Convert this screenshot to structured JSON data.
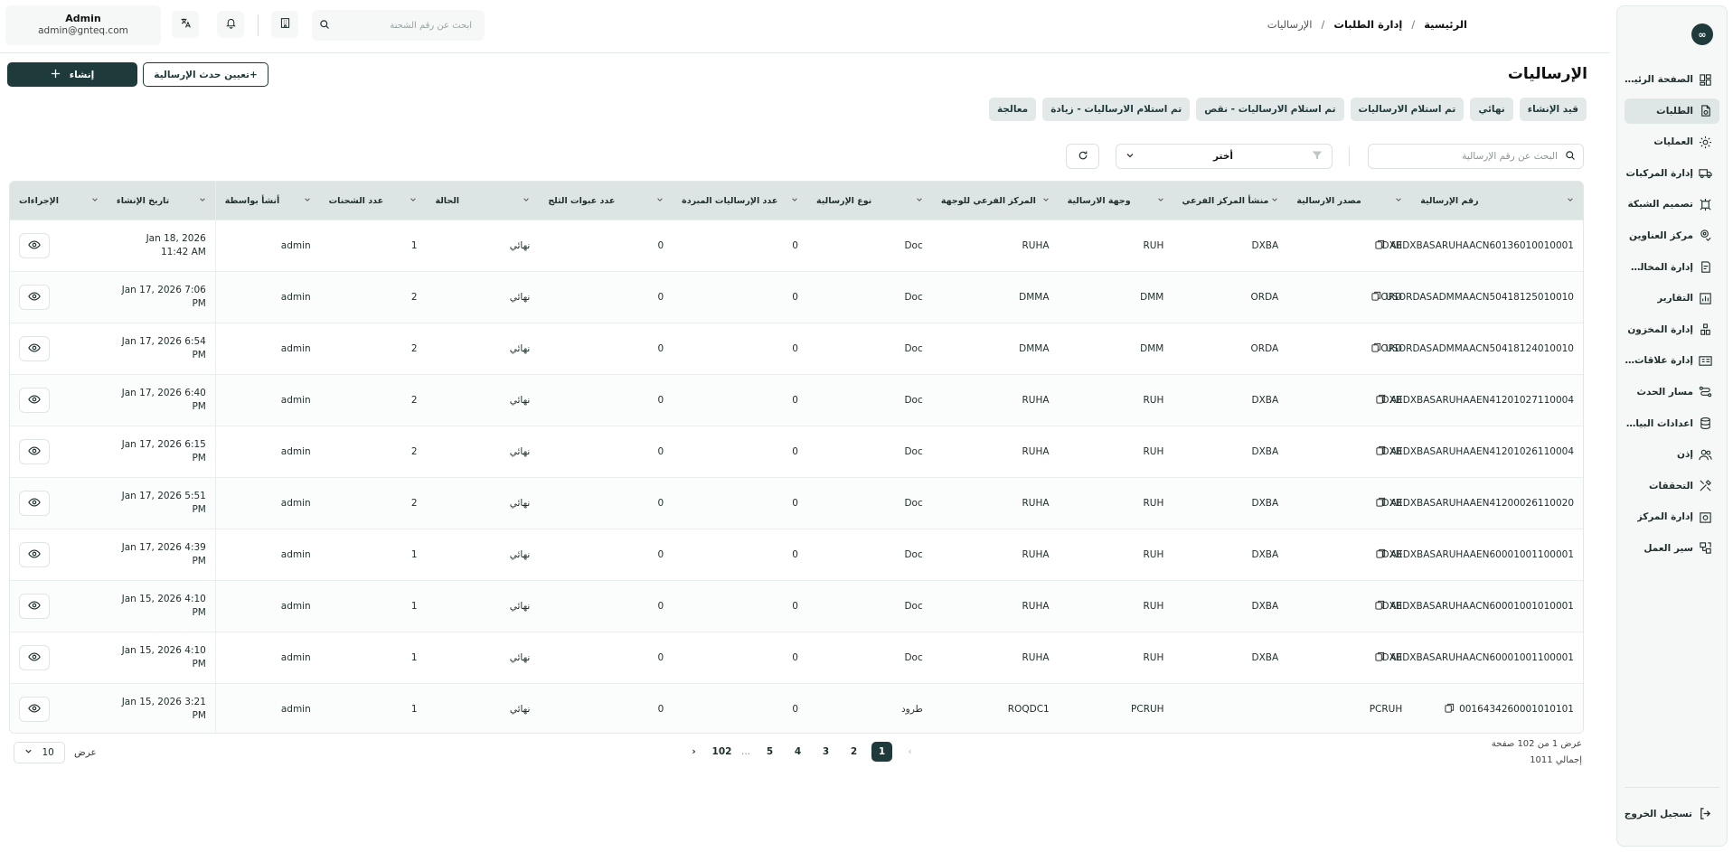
{
  "sidebar": {
    "logo": "∞",
    "items": [
      {
        "label": "الصفحة الرئيسية",
        "icon": "dashboard-icon"
      },
      {
        "label": "الطلبات",
        "icon": "orders-icon",
        "active": true
      },
      {
        "label": "العمليات",
        "icon": "operations-icon"
      },
      {
        "label": "إدارة المركبات",
        "icon": "truck-icon"
      },
      {
        "label": "تصميم الشبكة",
        "icon": "network-icon"
      },
      {
        "label": "مركز العناوين",
        "icon": "address-icon"
      },
      {
        "label": "إدارة المخالفات",
        "icon": "violation-icon"
      },
      {
        "label": "التقارير",
        "icon": "reports-icon"
      },
      {
        "label": "إدارة المخزون",
        "icon": "inventory-icon"
      },
      {
        "label": "إدارة علاقات العملاء",
        "icon": "crm-icon"
      },
      {
        "label": "مسار الحدث",
        "icon": "route-icon"
      },
      {
        "label": "اعدادات البيانات...",
        "icon": "database-icon"
      },
      {
        "label": "إذن",
        "icon": "users-icon"
      },
      {
        "label": "التحققات",
        "icon": "tools-icon"
      },
      {
        "label": "إدارة المركز",
        "icon": "center-icon"
      },
      {
        "label": "سير العمل",
        "icon": "workflow-icon"
      }
    ],
    "logout": "تسجيل الخروج"
  },
  "topbar": {
    "user_name": "Admin",
    "user_email": "admin@gnteq.com",
    "search_placeholder": "ابحث عن رقم الشحنة",
    "breadcrumb": [
      "الرئيسية",
      "إدارة الطلبات",
      "الإرساليات"
    ]
  },
  "page": {
    "title": "الإرساليات",
    "create_label": "إنشاء",
    "assign_label": "+تعيين حدث الإرسالية",
    "tabs": [
      "قيد الإنشاء",
      "نهائي",
      "تم استلام الارساليات",
      "تم استلام الارساليات - نقص",
      "تم استلام الارساليات - زيادة",
      "معالجة"
    ]
  },
  "filters": {
    "search_placeholder": "البحث عن رقم الإرسالية",
    "select_value": "أختر"
  },
  "table": {
    "columns": [
      "رقم الإرسالية",
      "مصدر الارسالية",
      "منشأ المركز الفرعي",
      "وجهة الارسالية",
      "المركز الفرعي للوجهة",
      "نوع الإرسالية",
      "عدد الإرساليات المبردة",
      "عدد عبوات الثلج",
      "الحالة",
      "عدد الشحنات",
      "أنشأ بواسطة",
      "تاريخ الإنشاء",
      "الإجراءات"
    ],
    "rows": [
      [
        "AEDXBASARUHAACN60136010010001",
        "DXB",
        "DXBA",
        "RUH",
        "RUHA",
        "Doc",
        "0",
        "0",
        "نهائي",
        "1",
        "admin",
        "Jan 18, 2026 11:42 AM"
      ],
      [
        "USORDASADMMAACN50418125010010",
        "ORD",
        "ORDA",
        "DMM",
        "DMMA",
        "Doc",
        "0",
        "0",
        "نهائي",
        "2",
        "admin",
        "Jan 17, 2026 7:06 PM"
      ],
      [
        "USORDASADMMAACN50418124010010",
        "ORD",
        "ORDA",
        "DMM",
        "DMMA",
        "Doc",
        "0",
        "0",
        "نهائي",
        "2",
        "admin",
        "Jan 17, 2026 6:54 PM"
      ],
      [
        "AEDXBASARUHAAEN41201027110004",
        "DXB",
        "DXBA",
        "RUH",
        "RUHA",
        "Doc",
        "0",
        "0",
        "نهائي",
        "2",
        "admin",
        "Jan 17, 2026 6:40 PM"
      ],
      [
        "AEDXBASARUHAAEN41201026110004",
        "DXB",
        "DXBA",
        "RUH",
        "RUHA",
        "Doc",
        "0",
        "0",
        "نهائي",
        "2",
        "admin",
        "Jan 17, 2026 6:15 PM"
      ],
      [
        "AEDXBASARUHAAEN41200026110020",
        "DXB",
        "DXBA",
        "RUH",
        "RUHA",
        "Doc",
        "0",
        "0",
        "نهائي",
        "2",
        "admin",
        "Jan 17, 2026 5:51 PM"
      ],
      [
        "AEDXBASARUHAAEN60001001100001",
        "DXB",
        "DXBA",
        "RUH",
        "RUHA",
        "Doc",
        "0",
        "0",
        "نهائي",
        "1",
        "admin",
        "Jan 17, 2026 4:39 PM"
      ],
      [
        "AEDXBASARUHAACN60001001010001",
        "DXB",
        "DXBA",
        "RUH",
        "RUHA",
        "Doc",
        "0",
        "0",
        "نهائي",
        "1",
        "admin",
        "Jan 15, 2026 4:10 PM"
      ],
      [
        "AEDXBASARUHAACN60001001100001",
        "DXB",
        "DXBA",
        "RUH",
        "RUHA",
        "Doc",
        "0",
        "0",
        "نهائي",
        "1",
        "admin",
        "Jan 15, 2026 4:10 PM"
      ],
      [
        "0016434260001010101",
        "PCRUH",
        "",
        "PCRUH",
        "ROQDC1",
        "طرود",
        "0",
        "0",
        "نهائي",
        "1",
        "admin",
        "Jan 15, 2026 3:21 PM"
      ]
    ]
  },
  "pagination": {
    "info": "عرض 1 من 102 صفحة",
    "total": "إجمالي 1011",
    "pages": [
      "1",
      "2",
      "3",
      "4",
      "5",
      "...",
      "102"
    ],
    "current": "1",
    "per_page": "10",
    "per_page_label": "عرض"
  },
  "colors": {
    "primary": "#1f3a3a",
    "header_bg": "#dde4e4",
    "tab_bg": "#e3e9e9"
  }
}
